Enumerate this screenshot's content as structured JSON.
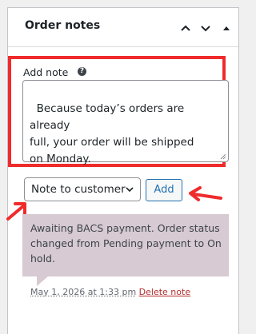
{
  "panel": {
    "title": "Order notes",
    "controls": [
      "chevron-up-icon",
      "chevron-down-icon",
      "triangle-up-icon"
    ]
  },
  "add_note": {
    "label": "Add note",
    "help_glyph": "?",
    "textarea_value": "Because today’s orders are already\nfull, your order will be shipped\non Monday.",
    "note_type_selected": "Note to customer",
    "add_button_label": "Add"
  },
  "notes": [
    {
      "text": "Awaiting BACS payment. Order status changed from Pending payment to On hold.",
      "date": "May 1, 2026 at 1:33 pm",
      "delete_label": "Delete note"
    }
  ],
  "colors": {
    "highlight": "#ef2b2b",
    "note_bubble": "#d7cad2",
    "accent": "#2271b1",
    "delete": "#b32d2e"
  }
}
